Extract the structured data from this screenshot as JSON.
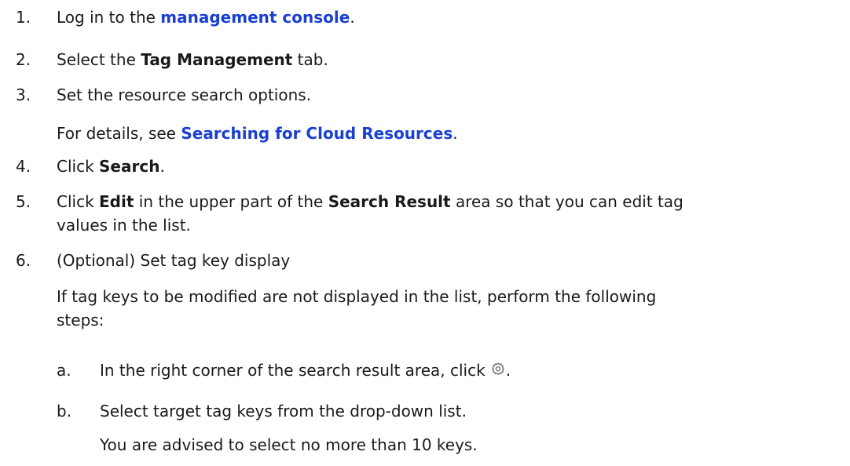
{
  "steps": {
    "s1": {
      "num": "1.",
      "pre": "Log in to the ",
      "link": "management console",
      "post": "."
    },
    "s2": {
      "num": "2.",
      "pre": "Select the ",
      "bold": "Tag Management",
      "post": " tab."
    },
    "s3": {
      "num": "3.",
      "text": "Set the resource search options.",
      "detail_pre": "For details, see ",
      "detail_link": "Searching for Cloud Resources",
      "detail_post": "."
    },
    "s4": {
      "num": "4.",
      "pre": "Click ",
      "bold": "Search",
      "post": "."
    },
    "s5": {
      "num": "5.",
      "pre": "Click ",
      "bold1": "Edit",
      "mid": " in the upper part of the ",
      "bold2": "Search Result",
      "post": " area so that you can edit tag",
      "line2": "values in the list."
    },
    "s6": {
      "num": "6.",
      "text": "(Optional) Set tag key display",
      "para_line1": "If tag keys to be modified are not displayed in the list, perform the following",
      "para_line2": "steps:",
      "sub_a": {
        "letter": "a.",
        "text": "In the right corner of the search result area, click",
        "icon": "gear-icon",
        "post": "."
      },
      "sub_b": {
        "letter": "b.",
        "text": "Select target tag keys from the drop-down list.",
        "note": "You are advised to select no more than 10 keys."
      }
    }
  },
  "colors": {
    "link": "#1a3fd1",
    "text": "#1a1a1a"
  }
}
